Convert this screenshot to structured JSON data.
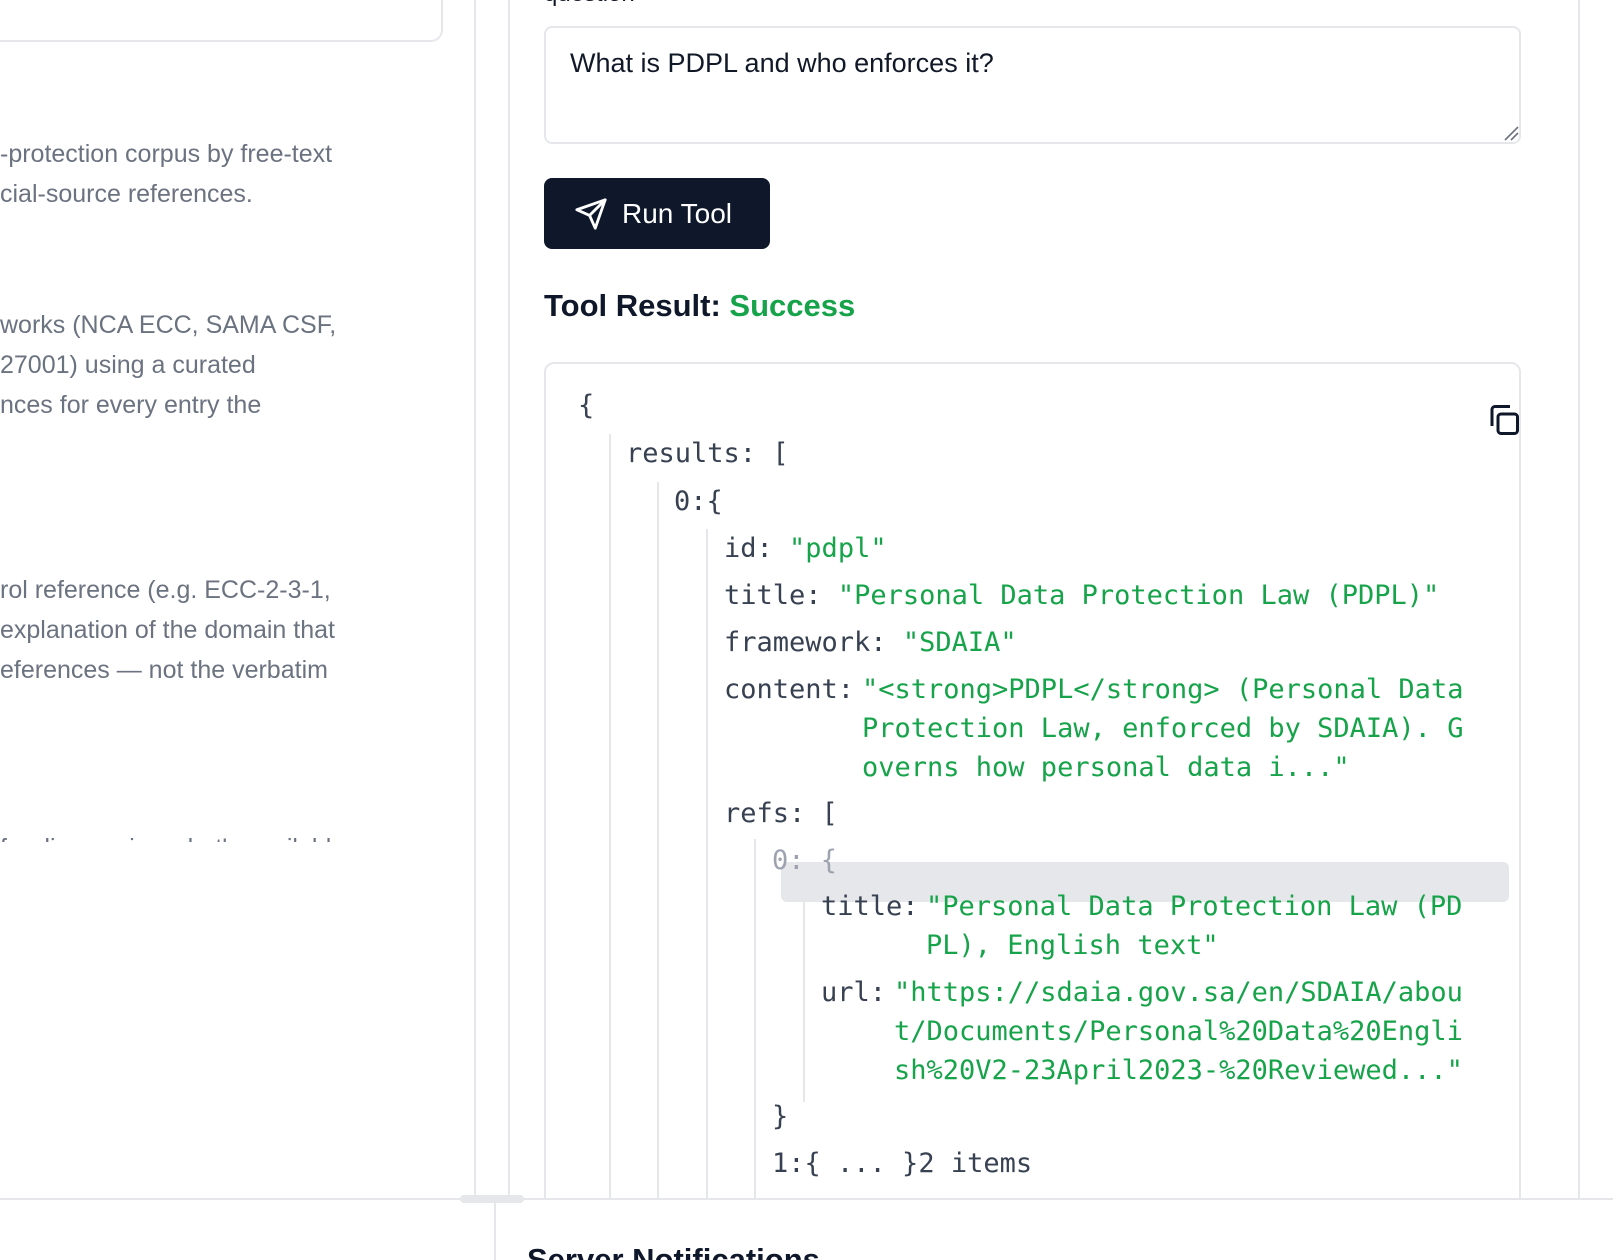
{
  "left_panel": {
    "tool_descriptions": [
      {
        "lines": [
          "-protection corpus by free-text",
          "cial-source references."
        ]
      },
      {
        "lines": [
          "works (NCA ECC, SAMA CSF,",
          "27001) using a curated",
          "nces for every entry the"
        ]
      },
      {
        "lines": [
          "rol reference (e.g. ECC-2-3-1,",
          "explanation of the domain that",
          "eferences — not the verbatim"
        ]
      },
      {
        "lines": [
          "for discovering what's available"
        ]
      }
    ]
  },
  "form": {
    "field_label": "question",
    "question_value": "What is PDPL and who enforces it?"
  },
  "run_button": {
    "label": "Run Tool",
    "icon": "send-icon"
  },
  "result": {
    "heading": "Tool Result:",
    "status": "Success",
    "status_color": "#16a34a",
    "json": {
      "open_brace": "{",
      "results_key": "results:",
      "results_open": "[",
      "item0_key": "0:",
      "item0_open": "{",
      "id_key": "id:",
      "id_val": "\"pdpl\"",
      "title_key": "title:",
      "title_val": "\"Personal Data Protection Law (PDPL)\"",
      "framework_key": "framework:",
      "framework_val": "\"SDAIA\"",
      "content_key": "content:",
      "content_lines": [
        "\"<strong>PDPL</strong> (Personal Data",
        "Protection Law, enforced by SDAIA). G",
        "overns how personal data i...\""
      ],
      "refs_key": "refs:",
      "refs_open": "[",
      "ref0_key": "0:",
      "ref0_open": "{",
      "ref_title_key": "title:",
      "ref_title_lines": [
        "\"Personal Data Protection Law (PD",
        "PL), English text\""
      ],
      "ref_url_key": "url:",
      "ref_url_lines": [
        "\"https://sdaia.gov.sa/en/SDAIA/abou",
        "t/Documents/Personal%20Data%20Engli",
        "sh%20V2-23April2023-%20Reviewed...\""
      ],
      "ref0_close": "}",
      "ref1_key": "1:",
      "ref1_collapsed": "{ ... }",
      "ref_count": "2 items"
    }
  },
  "bottom": {
    "notifications_title": "Server Notifications"
  }
}
